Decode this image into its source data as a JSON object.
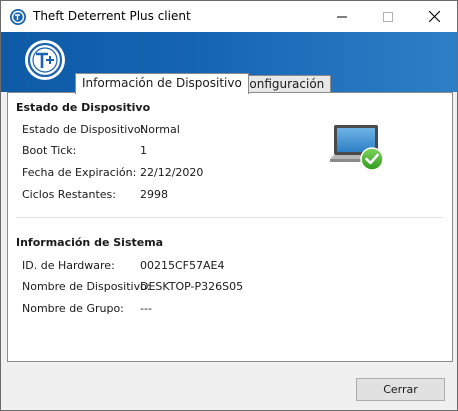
{
  "window": {
    "title": "Theft Deterrent Plus client"
  },
  "tabs": [
    {
      "label": "Información de Dispositivo"
    },
    {
      "label": "Configuración"
    }
  ],
  "device_status": {
    "heading": "Estado de Dispositivo",
    "rows": [
      {
        "label": "Estado de Dispositivo:",
        "value": "Normal"
      },
      {
        "label": "Boot Tick:",
        "value": "1"
      },
      {
        "label": "Fecha de Expiración:",
        "value": "22/12/2020"
      },
      {
        "label": "Ciclos Restantes:",
        "value": "2998"
      }
    ],
    "status_icon": "laptop-check-icon"
  },
  "system_info": {
    "heading": "Información de Sistema",
    "rows": [
      {
        "label": "ID. de Hardware:",
        "value": "00215CF57AE4"
      },
      {
        "label": "Nombre de Dispositivo:",
        "value": "DESKTOP-P326S05"
      },
      {
        "label": "Nombre de Grupo:",
        "value": "---"
      }
    ]
  },
  "footer": {
    "close_label": "Cerrar"
  },
  "colors": {
    "banner": "#1565b5",
    "check_green": "#3fae29"
  }
}
